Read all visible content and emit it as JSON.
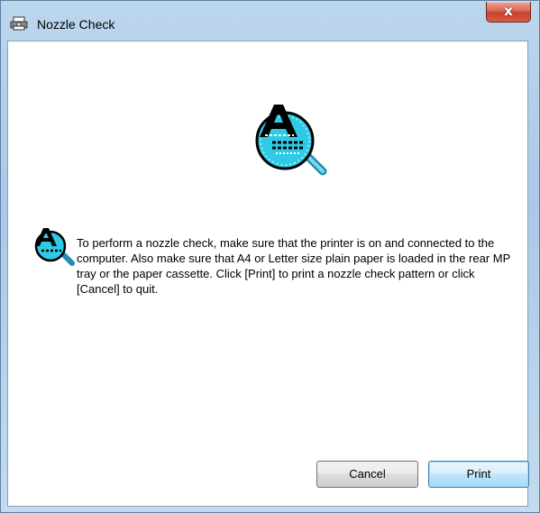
{
  "window": {
    "title": "Nozzle Check",
    "close_symbol": "x",
    "title_icon": "printer-icon"
  },
  "content": {
    "hero_icon": "nozzle-check-magnifier-icon",
    "info_icon": "nozzle-check-small-icon",
    "message": "To perform a nozzle check, make sure that the printer is on and connected to the computer. Also make sure that A4 or Letter size plain paper is loaded in the rear MP tray or the paper cassette. Click [Print] to print a nozzle check pattern or click [Cancel] to quit."
  },
  "buttons": {
    "cancel_label": "Cancel",
    "print_label": "Print"
  },
  "colors": {
    "frame": "#a9c9e6",
    "close_button": "#c8412c",
    "default_button_border": "#3c7fb1",
    "magnifier_lens": "#29c9e6"
  }
}
